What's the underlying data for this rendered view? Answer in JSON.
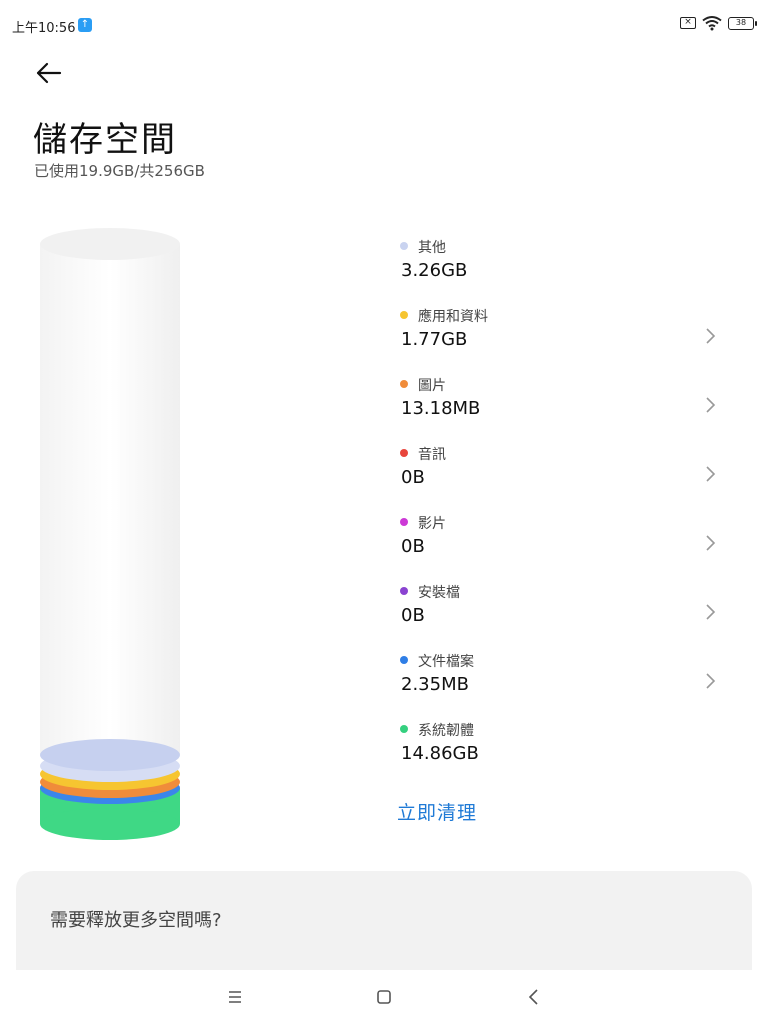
{
  "status_bar": {
    "time": "上午10:56",
    "upload_icon": "upload-arrow-icon",
    "battery": "38"
  },
  "header": {
    "title": "儲存空間",
    "summary": "已使用19.9GB/共256GB"
  },
  "categories": [
    {
      "name": "其他",
      "size": "3.26GB",
      "color": "#c9d3f0",
      "has_chevron": false
    },
    {
      "name": "應用和資料",
      "size": "1.77GB",
      "color": "#f6c531",
      "has_chevron": true
    },
    {
      "name": "圖片",
      "size": "13.18MB",
      "color": "#f08c3a",
      "has_chevron": true
    },
    {
      "name": "音訊",
      "size": "0B",
      "color": "#e8453c",
      "has_chevron": true
    },
    {
      "name": "影片",
      "size": "0B",
      "color": "#cc39d6",
      "has_chevron": true
    },
    {
      "name": "安裝檔",
      "size": "0B",
      "color": "#8a43d1",
      "has_chevron": true
    },
    {
      "name": "文件檔案",
      "size": "2.35MB",
      "color": "#2f7ee6",
      "has_chevron": true
    },
    {
      "name": "系統韌體",
      "size": "14.86GB",
      "color": "#35d07f",
      "has_chevron": false
    }
  ],
  "clean_button_label": "立即清理",
  "free_space_card": {
    "title": "需要釋放更多空間嗎?"
  },
  "nav_bar": {
    "icons": [
      "menu-icon",
      "home-icon",
      "back-icon"
    ]
  }
}
